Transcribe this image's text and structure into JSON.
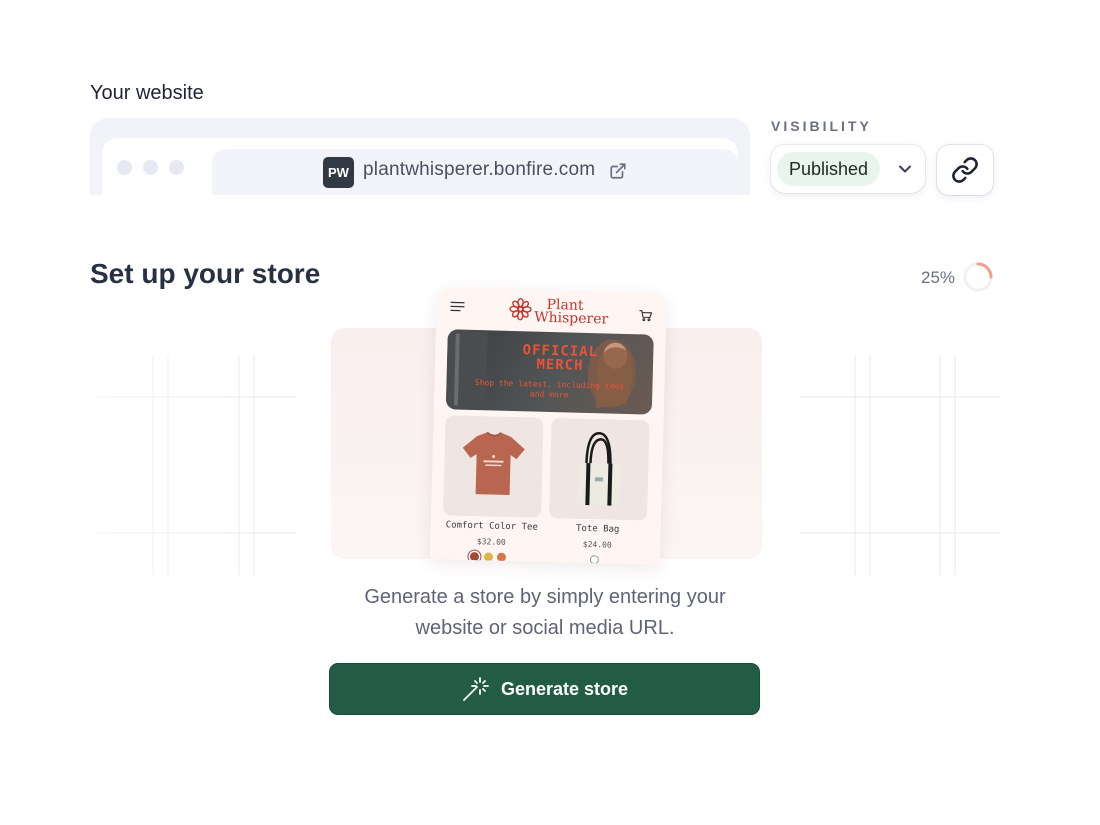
{
  "website": {
    "label": "Your website",
    "badge": "PW",
    "url": "plantwhisperer.bonfire.com"
  },
  "visibility": {
    "label": "VISIBILITY",
    "status": "Published"
  },
  "setup": {
    "title": "Set up your store",
    "progress_text": "25%",
    "progress": 0.25,
    "description_line1": "Generate a store by simply entering your",
    "description_line2": "website or social media URL.",
    "button_label": "Generate store"
  },
  "preview": {
    "brand_line1": "Plant",
    "brand_line2": "Whisperer",
    "hero_title": "OFFICIAL MERCH",
    "hero_sub": "Shop the latest, including tees and more",
    "products": [
      {
        "name": "Comfort Color Tee",
        "price": "$32.00"
      },
      {
        "name": "Tote Bag",
        "price": "$24.00"
      }
    ]
  },
  "colors": {
    "primary_button": "#235c44",
    "published_pill": "#e8f5ec",
    "brand_red": "#c7352c",
    "progress_ring": "#f0a08c"
  }
}
